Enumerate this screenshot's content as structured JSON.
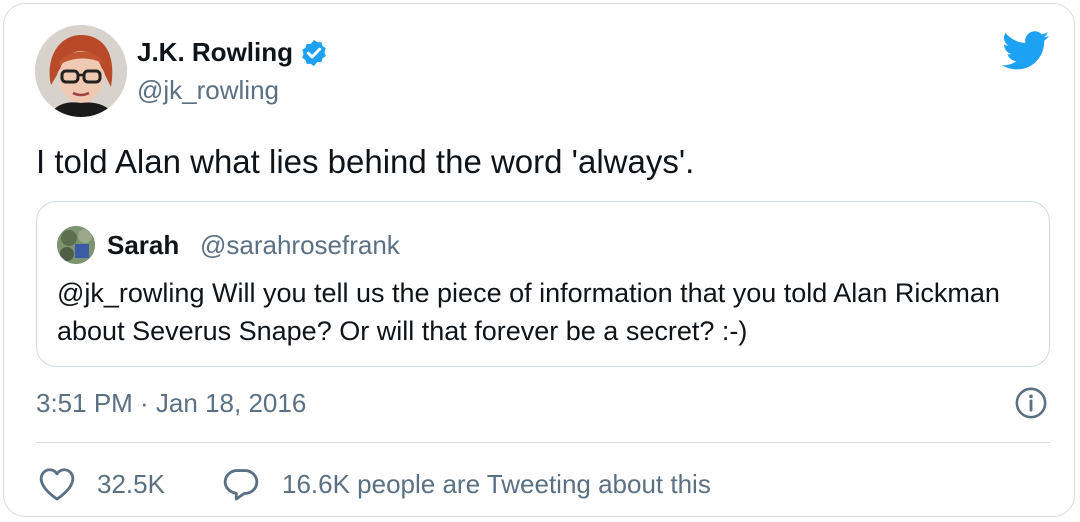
{
  "author": {
    "name": "J.K. Rowling",
    "handle": "@jk_rowling",
    "verified": true
  },
  "tweet": {
    "text": "I told Alan what lies behind the word 'always'."
  },
  "quoted_tweet": {
    "name": "Sarah",
    "handle": "@sarahrosefrank",
    "text": "@jk_rowling Will you tell us the piece of information that you told Alan Rickman about Severus Snape? Or will that forever be a secret? :-)"
  },
  "meta": {
    "timestamp": "3:51 PM · Jan 18, 2016"
  },
  "actions": {
    "like_count": "32.5K",
    "reply_text": "16.6K people are Tweeting about this"
  },
  "icons": {
    "brand": "twitter-bird-icon",
    "verified": "verified-badge-icon",
    "info": "info-icon",
    "like": "heart-icon",
    "reply": "speech-bubble-icon"
  },
  "colors": {
    "twitter_blue": "#1da1f2",
    "text_primary": "#0f1419",
    "text_secondary": "#5b7083",
    "border": "#d6dbe0"
  }
}
